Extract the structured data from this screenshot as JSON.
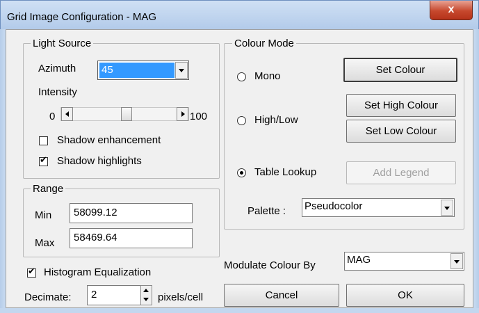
{
  "window": {
    "title": "Grid Image Configuration - MAG",
    "close_glyph": "x"
  },
  "light_source": {
    "group_label": "Light Source",
    "azimuth_label": "Azimuth",
    "azimuth_value": "45",
    "intensity_label": "Intensity",
    "intensity_min": "0",
    "intensity_max": "100",
    "shadow_enhancement_label": "Shadow enhancement",
    "shadow_enhancement_checked": false,
    "shadow_highlights_label": "Shadow highlights",
    "shadow_highlights_checked": true
  },
  "range": {
    "group_label": "Range",
    "min_label": "Min",
    "min_value": "58099.12",
    "max_label": "Max",
    "max_value": "58469.64"
  },
  "colour_mode": {
    "group_label": "Colour Mode",
    "mono_label": "Mono",
    "high_low_label": "High/Low",
    "table_lookup_label": "Table Lookup",
    "selected": "table_lookup",
    "set_colour_label": "Set Colour",
    "set_high_colour_label": "Set High Colour",
    "set_low_colour_label": "Set Low Colour",
    "add_legend_label": "Add Legend",
    "palette_label": "Palette :",
    "palette_value": "Pseudocolor"
  },
  "histogram": {
    "label": "Histogram Equalization",
    "checked": true
  },
  "decimate": {
    "label": "Decimate:",
    "value": "2",
    "unit": "pixels/cell"
  },
  "modulate": {
    "label": "Modulate Colour By",
    "value": "MAG"
  },
  "buttons": {
    "cancel": "Cancel",
    "ok": "OK"
  },
  "colors": {
    "selection": "#3399ff",
    "titlebar": "#c4d8f0",
    "close": "#c6482d"
  }
}
